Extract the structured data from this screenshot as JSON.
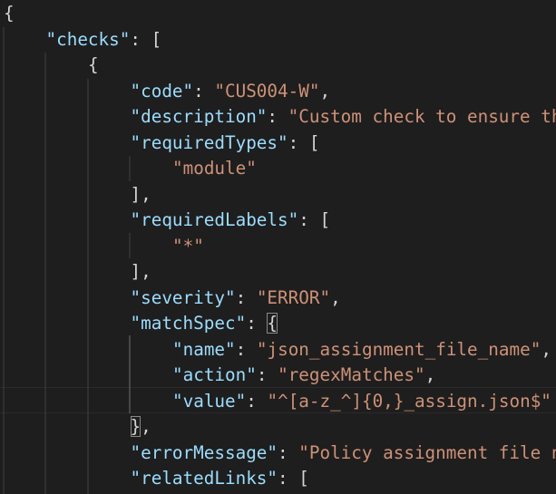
{
  "editor": {
    "lines": [
      {
        "indent": 0,
        "tokens": [
          {
            "t": "p",
            "v": "{"
          }
        ]
      },
      {
        "indent": 1,
        "tokens": [
          {
            "t": "k",
            "v": "\"checks\""
          },
          {
            "t": "p",
            "v": ": ["
          }
        ]
      },
      {
        "indent": 2,
        "tokens": [
          {
            "t": "p",
            "v": "{"
          }
        ]
      },
      {
        "indent": 3,
        "tokens": [
          {
            "t": "k",
            "v": "\"code\""
          },
          {
            "t": "p",
            "v": ": "
          },
          {
            "t": "s",
            "v": "\"CUS004-W\""
          },
          {
            "t": "p",
            "v": ","
          }
        ]
      },
      {
        "indent": 3,
        "tokens": [
          {
            "t": "k",
            "v": "\"description\""
          },
          {
            "t": "p",
            "v": ": "
          },
          {
            "t": "s",
            "v": "\"Custom check to ensure th"
          }
        ]
      },
      {
        "indent": 3,
        "tokens": [
          {
            "t": "k",
            "v": "\"requiredTypes\""
          },
          {
            "t": "p",
            "v": ": ["
          }
        ]
      },
      {
        "indent": 4,
        "tokens": [
          {
            "t": "s",
            "v": "\"module\""
          }
        ]
      },
      {
        "indent": 3,
        "tokens": [
          {
            "t": "p",
            "v": "],"
          }
        ]
      },
      {
        "indent": 3,
        "tokens": [
          {
            "t": "k",
            "v": "\"requiredLabels\""
          },
          {
            "t": "p",
            "v": ": ["
          }
        ]
      },
      {
        "indent": 4,
        "tokens": [
          {
            "t": "s",
            "v": "\"*\""
          }
        ]
      },
      {
        "indent": 3,
        "tokens": [
          {
            "t": "p",
            "v": "],"
          }
        ]
      },
      {
        "indent": 3,
        "tokens": [
          {
            "t": "k",
            "v": "\"severity\""
          },
          {
            "t": "p",
            "v": ": "
          },
          {
            "t": "s",
            "v": "\"ERROR\""
          },
          {
            "t": "p",
            "v": ","
          }
        ]
      },
      {
        "indent": 3,
        "tokens": [
          {
            "t": "k",
            "v": "\"matchSpec\""
          },
          {
            "t": "p",
            "v": ": "
          },
          {
            "t": "p",
            "v": "{",
            "bm": true
          }
        ]
      },
      {
        "indent": 4,
        "tokens": [
          {
            "t": "k",
            "v": "\"name\""
          },
          {
            "t": "p",
            "v": ": "
          },
          {
            "t": "s",
            "v": "\"json_assignment_file_name\""
          },
          {
            "t": "p",
            "v": ","
          }
        ]
      },
      {
        "indent": 4,
        "tokens": [
          {
            "t": "k",
            "v": "\"action\""
          },
          {
            "t": "p",
            "v": ": "
          },
          {
            "t": "s",
            "v": "\"regexMatches\""
          },
          {
            "t": "p",
            "v": ","
          }
        ]
      },
      {
        "indent": 4,
        "tokens": [
          {
            "t": "k",
            "v": "\"value\""
          },
          {
            "t": "p",
            "v": ": "
          },
          {
            "t": "s",
            "v": "\"^[a-z_^]{0,}_assign.json$\""
          }
        ]
      },
      {
        "indent": 3,
        "tokens": [
          {
            "t": "p",
            "v": "}",
            "bm": true
          },
          {
            "t": "p",
            "v": ","
          }
        ]
      },
      {
        "indent": 3,
        "tokens": [
          {
            "t": "k",
            "v": "\"errorMessage\""
          },
          {
            "t": "p",
            "v": ": "
          },
          {
            "t": "s",
            "v": "\"Policy assignment file n"
          }
        ]
      },
      {
        "indent": 3,
        "tokens": [
          {
            "t": "k",
            "v": "\"relatedLinks\""
          },
          {
            "t": "p",
            "v": ": ["
          }
        ]
      }
    ]
  }
}
